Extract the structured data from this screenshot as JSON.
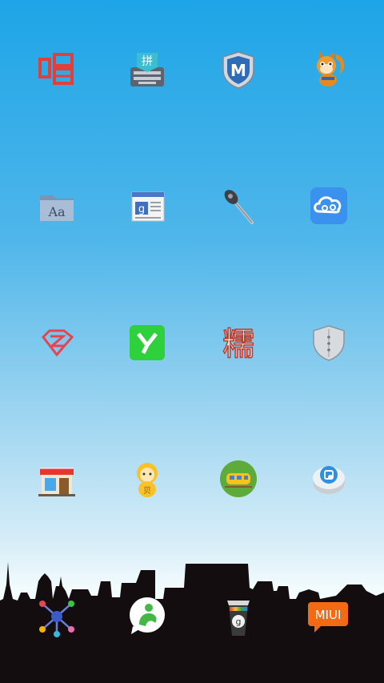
{
  "screen": {
    "background_top": "#1ea5e7",
    "background_bottom": "#f2fbfd",
    "skyline_color": "#140d0f"
  },
  "apps": [
    {
      "name": "singing-app",
      "icon": "chang-character-icon"
    },
    {
      "name": "pinyin-keyboard",
      "icon": "keyboard-pin-icon",
      "glyph": "拼"
    },
    {
      "name": "security-shield",
      "icon": "m-shield-icon",
      "glyph": "M"
    },
    {
      "name": "uc-browser",
      "icon": "squirrel-icon"
    },
    {
      "name": "font-manager",
      "icon": "folder-aa-icon",
      "glyph": "Aa"
    },
    {
      "name": "google-news",
      "icon": "newspaper-g-icon",
      "glyph": "g"
    },
    {
      "name": "tools-app",
      "icon": "screwdriver-icon"
    },
    {
      "name": "cloud-app",
      "icon": "cloud-swirl-icon"
    },
    {
      "name": "diamond-app",
      "icon": "diamond-z-icon"
    },
    {
      "name": "y-app",
      "icon": "green-y-icon"
    },
    {
      "name": "nuo-app",
      "icon": "nuo-character-icon",
      "glyph": "糯"
    },
    {
      "name": "guard-app",
      "icon": "silver-shield-icon"
    },
    {
      "name": "store-app",
      "icon": "shop-front-icon"
    },
    {
      "name": "baby-app",
      "icon": "yellow-baby-icon",
      "glyph": "贝"
    },
    {
      "name": "train-app",
      "icon": "train-icon"
    },
    {
      "name": "disk-app",
      "icon": "blue-button-icon"
    }
  ],
  "dock": [
    {
      "name": "network-app",
      "icon": "network-nodes-icon"
    },
    {
      "name": "chat-app",
      "icon": "green-person-bubble-icon"
    },
    {
      "name": "coffee-app",
      "icon": "coffee-cup-icon",
      "glyph": "g"
    },
    {
      "name": "miui-app",
      "icon": "miui-bubble-icon",
      "label": "MIUI"
    }
  ]
}
